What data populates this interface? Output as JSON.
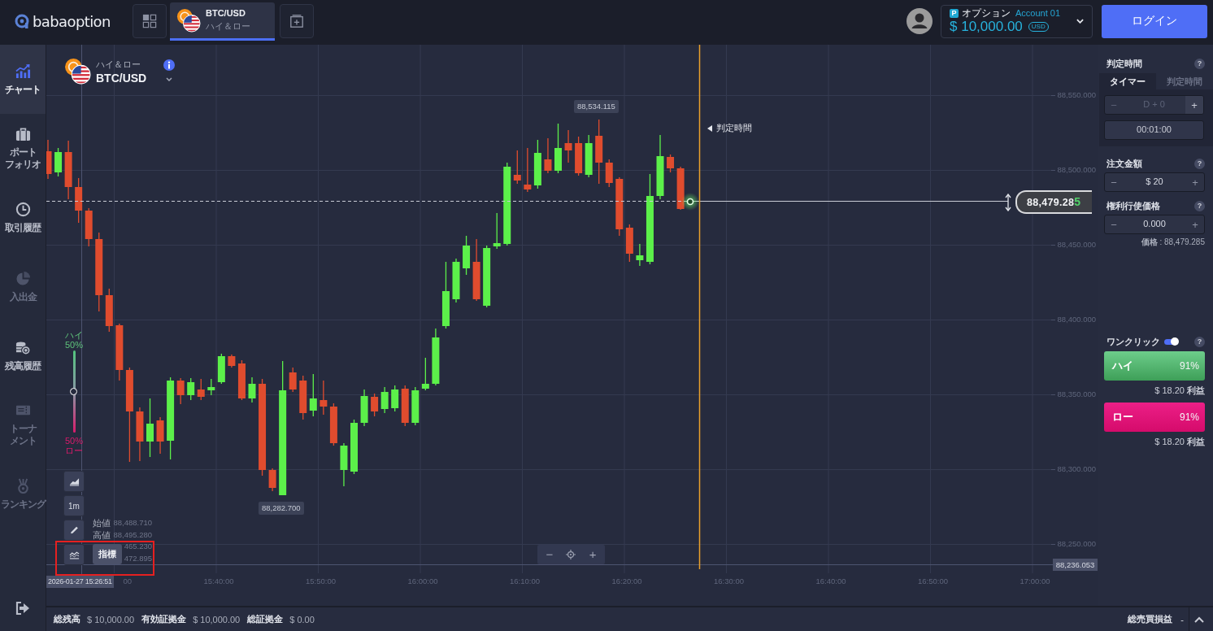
{
  "header": {
    "logo": "babaoption",
    "tabs": [
      {
        "pair": "BTC/USD",
        "mode": "ハイ＆ロー",
        "selected": true
      }
    ],
    "account": {
      "badge": "P",
      "type": "オプション",
      "name": "Account 01",
      "balance": "$ 10,000.00",
      "currency": "USD"
    },
    "login_button": "ログイン"
  },
  "sidebar": {
    "items": [
      {
        "lines": [
          "チャート"
        ],
        "selected": true,
        "disabled": false
      },
      {
        "lines": [
          "ポート",
          "フォリオ"
        ],
        "selected": false,
        "disabled": false
      },
      {
        "lines": [
          "取引履歴"
        ],
        "selected": false,
        "disabled": false
      },
      {
        "lines": [
          "入出金"
        ],
        "selected": false,
        "disabled": true
      },
      {
        "lines": [
          "残高履歴"
        ],
        "selected": false,
        "disabled": false
      },
      {
        "lines": [
          "トーナ",
          "メント"
        ],
        "selected": false,
        "disabled": true
      },
      {
        "lines": [
          "ランキング"
        ],
        "selected": false,
        "disabled": true
      }
    ]
  },
  "chart": {
    "asset": {
      "mode": "ハイ＆ロー",
      "pair": "BTC/USD"
    },
    "sentiment": {
      "high_label": "ハイ",
      "high_percent": "50%",
      "low_percent": "50%",
      "low_label": "ロー",
      "level": 0.5
    },
    "tools": [
      {
        "kind": "chart_type",
        "highlighted": false
      },
      {
        "kind": "timeframe",
        "label": "1m",
        "highlighted": false
      },
      {
        "kind": "drawing",
        "highlighted": false
      },
      {
        "kind": "indicator",
        "tooltip": "指標",
        "highlighted": true
      }
    ],
    "ohlc": [
      {
        "label": "始値",
        "value": "88,488.710"
      },
      {
        "label": "高値",
        "value": "88,495.280"
      }
    ],
    "ohlc_partly_hidden_values": [
      "465.230",
      "472.895"
    ],
    "zoom_controls": {
      "minus": "−",
      "plus": "+"
    },
    "high_marker": "88,534.115",
    "low_marker": "88,282.700",
    "expiry_label": "判定時間",
    "current_price": "88,479.285",
    "crosshair": {
      "time": "2026-01-27 15:26:51",
      "price": "88,236.053"
    },
    "y_axis": [
      "88,550.000",
      "88,500.000",
      "88,450.000",
      "88,400.000",
      "88,350.000",
      "88,300.000",
      "88,250.000"
    ],
    "x_axis": [
      "00",
      "15:40:00",
      "15:50:00",
      "16:00:00",
      "16:10:00",
      "16:20:00",
      "16:30:00",
      "16:40:00",
      "16:50:00",
      "17:00:00"
    ]
  },
  "order_panel": {
    "expiry": {
      "title": "判定時間",
      "help": "?",
      "tabs": [
        {
          "label": "タイマー",
          "selected": true
        },
        {
          "label": "判定時間",
          "selected": false
        }
      ],
      "day_stepper": {
        "minus": "−",
        "value": "D + 0",
        "plus": "+",
        "disabled": true
      },
      "time": "00:01:00"
    },
    "amount": {
      "title": "注文金額",
      "help": "?",
      "minus": "−",
      "value": "$ 20",
      "plus": "+"
    },
    "strike": {
      "title": "権利行使価格",
      "help": "?",
      "minus": "−",
      "value": "0.000",
      "plus": "+",
      "note": "**価格** : 88,479.285"
    },
    "one_click": {
      "label": "ワンクリック",
      "on": true,
      "help": "?"
    },
    "trades": [
      {
        "kind": "high",
        "label": "ハイ",
        "payout": "91%",
        "profit": "$ 18.20 **利益**"
      },
      {
        "kind": "low",
        "label": "ロー",
        "payout": "91%",
        "profit": "$ 18.20 **利益**"
      }
    ]
  },
  "status_bar": {
    "balances": [
      {
        "label": "総残高",
        "value": "$ 10,000.00"
      },
      {
        "label": "有効証拠金",
        "value": "$ 10,000.00"
      },
      {
        "label": "総証拠金",
        "value": "$ 0.00"
      }
    ],
    "pnl": {
      "label": "総売買損益",
      "value": "-"
    }
  }
}
